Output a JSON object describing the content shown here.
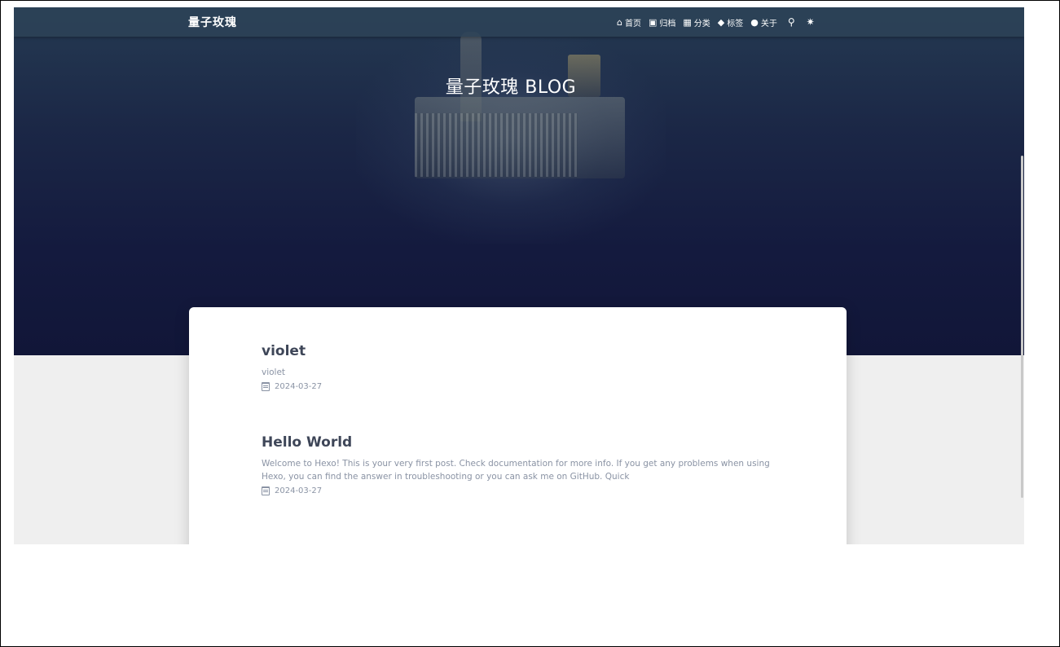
{
  "nav": {
    "brand": "量子玫瑰",
    "items": [
      {
        "icon": "home-icon",
        "glyph": "⌂",
        "label": "首页"
      },
      {
        "icon": "archive-icon",
        "glyph": "▣",
        "label": "归档"
      },
      {
        "icon": "categories-icon",
        "glyph": "▦",
        "label": "分类"
      },
      {
        "icon": "tags-icon",
        "glyph": "◆",
        "label": "标签"
      },
      {
        "icon": "user-icon",
        "glyph": "●",
        "label": "关于"
      }
    ],
    "search_glyph": "⚲",
    "theme_glyph": "✷"
  },
  "hero": {
    "title": "量子玫瑰 BLOG"
  },
  "posts": [
    {
      "title": "violet",
      "excerpt": "violet",
      "date": "2024-03-27"
    },
    {
      "title": "Hello World",
      "excerpt": "Welcome to Hexo! This is your very first post. Check documentation for more info. If you get any problems when using Hexo, you can find the answer in troubleshooting or you can ask me on GitHub. Quick",
      "date": "2024-03-27"
    }
  ],
  "colors": {
    "navbar": "#2c4256",
    "hero_dark": "#111638",
    "title_text": "#3e4658",
    "muted_text": "#8a93a4",
    "page_bg": "#efefef"
  }
}
